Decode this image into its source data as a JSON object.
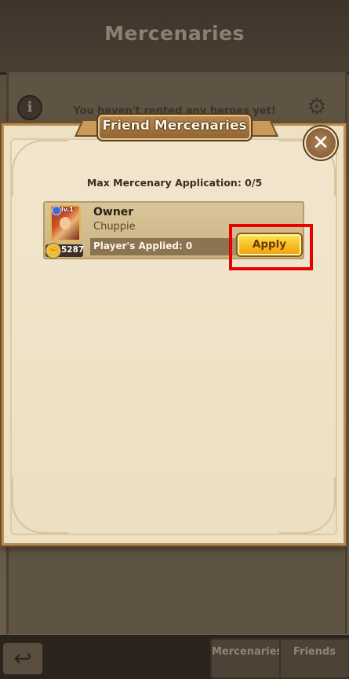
{
  "background": {
    "title": "Mercenaries",
    "empty_message": "You haven't rented any heroes yet!",
    "info_icon": "info-icon",
    "settings_icon": "gear-icon",
    "back_icon": "back-arrow-icon",
    "tabs": [
      {
        "label": "Mercenaries"
      },
      {
        "label": "Friends"
      }
    ]
  },
  "modal": {
    "title": "Friend Mercenaries",
    "close_icon": "close-icon",
    "max_application": "Max Mercenary Application: 0/5",
    "mercenaries": [
      {
        "role": "Owner",
        "name": "Chuppie",
        "level": "lv.1",
        "power": "5287",
        "players_applied": "Player's Applied: 0",
        "action_label": "Apply"
      }
    ]
  },
  "colors": {
    "highlight": "#ea0000",
    "apply_button": "#f7c322",
    "modal_bg": "#ede0c3"
  }
}
